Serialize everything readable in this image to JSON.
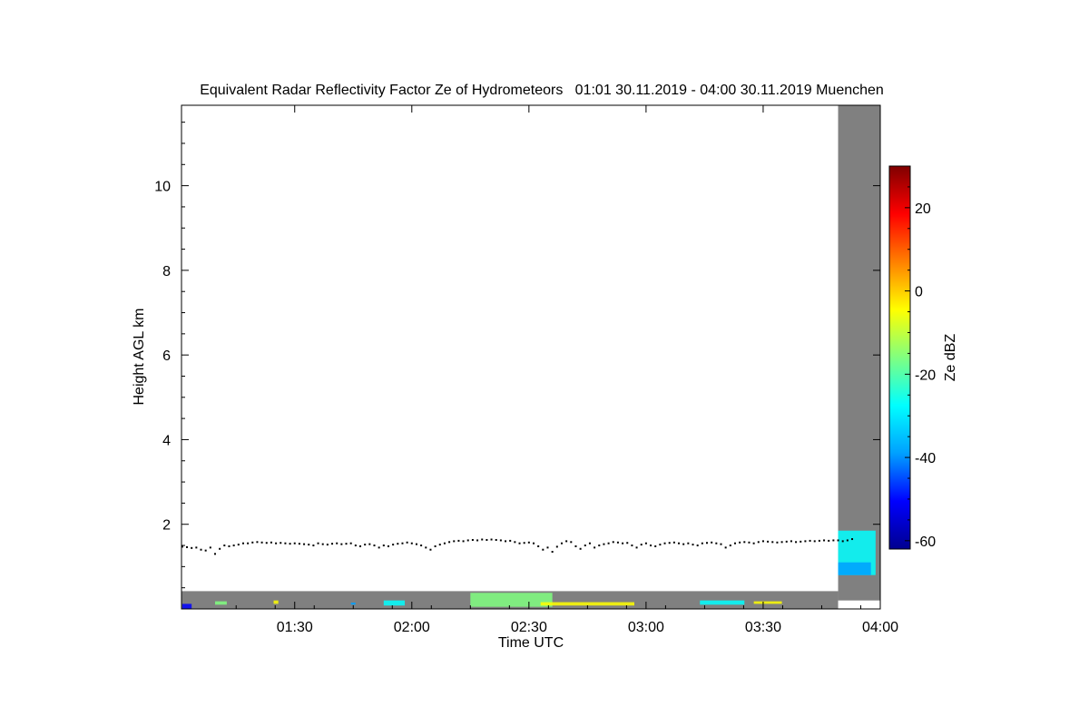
{
  "chart_data": {
    "type": "heatmap",
    "title": "Equivalent Radar Reflectivity Factor Ze of Hydrometeors   01:01 30.11.2019 - 04:00 30.11.2019 Muenchen",
    "xlabel": "Time UTC",
    "ylabel": "Height AGL km",
    "xlim": [
      1.0167,
      4.0
    ],
    "ylim": [
      0,
      11.9
    ],
    "x_ticks": [
      {
        "value": 1.5,
        "label": "01:30"
      },
      {
        "value": 2.0,
        "label": "02:00"
      },
      {
        "value": 2.5,
        "label": "02:30"
      },
      {
        "value": 3.0,
        "label": "03:00"
      },
      {
        "value": 3.5,
        "label": "03:30"
      },
      {
        "value": 4.0,
        "label": "04:00"
      }
    ],
    "y_ticks": [
      {
        "value": 2,
        "label": "2"
      },
      {
        "value": 4,
        "label": "4"
      },
      {
        "value": 6,
        "label": "6"
      },
      {
        "value": 8,
        "label": "8"
      },
      {
        "value": 10,
        "label": "10"
      }
    ],
    "colorbar": {
      "label": "Ze dBZ",
      "range": [
        -62,
        30
      ],
      "ticks": [
        {
          "value": 20,
          "label": "20"
        },
        {
          "value": 0,
          "label": "0"
        },
        {
          "value": -20,
          "label": "-20"
        },
        {
          "value": -40,
          "label": "-40"
        },
        {
          "value": -60,
          "label": "-60"
        }
      ],
      "colors": [
        "#00008f",
        "#0000ff",
        "#00a0ff",
        "#00ffff",
        "#80ff80",
        "#ffff00",
        "#ff8000",
        "#ff0000",
        "#800000"
      ]
    },
    "no_data_regions": [
      {
        "x": [
          1.0167,
          3.82
        ],
        "y": [
          0,
          0.42
        ],
        "color": "#808080"
      },
      {
        "x": [
          3.82,
          4.0
        ],
        "y": [
          0.2,
          11.9
        ],
        "color": "#808080"
      }
    ],
    "cloud_base_series": {
      "name": "",
      "color": "#000000",
      "points": [
        [
          1.02,
          1.47
        ],
        [
          1.04,
          1.46
        ],
        [
          1.06,
          1.44
        ],
        [
          1.08,
          1.45
        ],
        [
          1.1,
          1.4
        ],
        [
          1.12,
          1.38
        ],
        [
          1.14,
          1.45
        ],
        [
          1.16,
          1.3
        ],
        [
          1.18,
          1.42
        ],
        [
          1.2,
          1.5
        ],
        [
          1.22,
          1.48
        ],
        [
          1.24,
          1.5
        ],
        [
          1.26,
          1.52
        ],
        [
          1.28,
          1.55
        ],
        [
          1.3,
          1.55
        ],
        [
          1.32,
          1.57
        ],
        [
          1.34,
          1.58
        ],
        [
          1.36,
          1.57
        ],
        [
          1.38,
          1.56
        ],
        [
          1.4,
          1.57
        ],
        [
          1.42,
          1.55
        ],
        [
          1.44,
          1.56
        ],
        [
          1.46,
          1.55
        ],
        [
          1.48,
          1.54
        ],
        [
          1.5,
          1.55
        ],
        [
          1.52,
          1.54
        ],
        [
          1.54,
          1.53
        ],
        [
          1.56,
          1.52
        ],
        [
          1.58,
          1.5
        ],
        [
          1.6,
          1.55
        ],
        [
          1.62,
          1.53
        ],
        [
          1.64,
          1.52
        ],
        [
          1.66,
          1.54
        ],
        [
          1.68,
          1.55
        ],
        [
          1.7,
          1.53
        ],
        [
          1.72,
          1.54
        ],
        [
          1.74,
          1.55
        ],
        [
          1.76,
          1.5
        ],
        [
          1.78,
          1.48
        ],
        [
          1.8,
          1.52
        ],
        [
          1.82,
          1.53
        ],
        [
          1.84,
          1.5
        ],
        [
          1.86,
          1.45
        ],
        [
          1.88,
          1.5
        ],
        [
          1.9,
          1.48
        ],
        [
          1.92,
          1.52
        ],
        [
          1.94,
          1.54
        ],
        [
          1.96,
          1.55
        ],
        [
          1.98,
          1.57
        ],
        [
          2.0,
          1.55
        ],
        [
          2.02,
          1.53
        ],
        [
          2.04,
          1.5
        ],
        [
          2.06,
          1.45
        ],
        [
          2.08,
          1.4
        ],
        [
          2.1,
          1.48
        ],
        [
          2.12,
          1.52
        ],
        [
          2.14,
          1.55
        ],
        [
          2.16,
          1.58
        ],
        [
          2.18,
          1.6
        ],
        [
          2.2,
          1.61
        ],
        [
          2.22,
          1.6
        ],
        [
          2.24,
          1.62
        ],
        [
          2.26,
          1.63
        ],
        [
          2.28,
          1.62
        ],
        [
          2.3,
          1.64
        ],
        [
          2.32,
          1.63
        ],
        [
          2.34,
          1.64
        ],
        [
          2.36,
          1.63
        ],
        [
          2.38,
          1.62
        ],
        [
          2.4,
          1.6
        ],
        [
          2.42,
          1.61
        ],
        [
          2.44,
          1.58
        ],
        [
          2.46,
          1.55
        ],
        [
          2.48,
          1.56
        ],
        [
          2.5,
          1.57
        ],
        [
          2.52,
          1.55
        ],
        [
          2.54,
          1.48
        ],
        [
          2.56,
          1.4
        ],
        [
          2.58,
          1.45
        ],
        [
          2.6,
          1.35
        ],
        [
          2.62,
          1.47
        ],
        [
          2.64,
          1.55
        ],
        [
          2.66,
          1.6
        ],
        [
          2.68,
          1.58
        ],
        [
          2.7,
          1.48
        ],
        [
          2.72,
          1.42
        ],
        [
          2.74,
          1.5
        ],
        [
          2.76,
          1.55
        ],
        [
          2.78,
          1.45
        ],
        [
          2.8,
          1.5
        ],
        [
          2.82,
          1.53
        ],
        [
          2.84,
          1.55
        ],
        [
          2.86,
          1.58
        ],
        [
          2.88,
          1.57
        ],
        [
          2.9,
          1.55
        ],
        [
          2.92,
          1.56
        ],
        [
          2.94,
          1.5
        ],
        [
          2.96,
          1.45
        ],
        [
          2.98,
          1.52
        ],
        [
          3.0,
          1.55
        ],
        [
          3.02,
          1.5
        ],
        [
          3.04,
          1.48
        ],
        [
          3.06,
          1.52
        ],
        [
          3.08,
          1.55
        ],
        [
          3.1,
          1.56
        ],
        [
          3.12,
          1.57
        ],
        [
          3.14,
          1.55
        ],
        [
          3.16,
          1.53
        ],
        [
          3.18,
          1.55
        ],
        [
          3.2,
          1.52
        ],
        [
          3.22,
          1.5
        ],
        [
          3.24,
          1.55
        ],
        [
          3.26,
          1.56
        ],
        [
          3.28,
          1.57
        ],
        [
          3.3,
          1.55
        ],
        [
          3.32,
          1.53
        ],
        [
          3.34,
          1.45
        ],
        [
          3.36,
          1.5
        ],
        [
          3.38,
          1.55
        ],
        [
          3.4,
          1.57
        ],
        [
          3.42,
          1.58
        ],
        [
          3.44,
          1.57
        ],
        [
          3.46,
          1.55
        ],
        [
          3.48,
          1.58
        ],
        [
          3.5,
          1.6
        ],
        [
          3.52,
          1.59
        ],
        [
          3.54,
          1.58
        ],
        [
          3.56,
          1.57
        ],
        [
          3.58,
          1.58
        ],
        [
          3.6,
          1.59
        ],
        [
          3.62,
          1.6
        ],
        [
          3.64,
          1.58
        ],
        [
          3.66,
          1.59
        ],
        [
          3.68,
          1.6
        ],
        [
          3.7,
          1.61
        ],
        [
          3.72,
          1.6
        ],
        [
          3.74,
          1.61
        ],
        [
          3.76,
          1.62
        ],
        [
          3.78,
          1.61
        ],
        [
          3.8,
          1.62
        ],
        [
          3.82,
          1.62
        ],
        [
          3.84,
          1.6
        ],
        [
          3.86,
          1.62
        ],
        [
          3.88,
          1.65
        ]
      ]
    },
    "echoes": [
      {
        "x": [
          1.02,
          1.06
        ],
        "y": [
          0.0,
          0.12
        ],
        "ze": -45
      },
      {
        "x": [
          1.16,
          1.21
        ],
        "y": [
          0.1,
          0.18
        ],
        "ze": -15
      },
      {
        "x": [
          1.41,
          1.43
        ],
        "y": [
          0.12,
          0.2
        ],
        "ze": -10
      },
      {
        "x": [
          1.74,
          1.76
        ],
        "y": [
          0.1,
          0.15
        ],
        "ze": -40
      },
      {
        "x": [
          1.88,
          1.97
        ],
        "y": [
          0.08,
          0.2
        ],
        "ze": -22
      },
      {
        "x": [
          2.25,
          2.6
        ],
        "y": [
          0.05,
          0.38
        ],
        "ze": -18
      },
      {
        "x": [
          2.55,
          2.95
        ],
        "y": [
          0.08,
          0.16
        ],
        "ze": -8
      },
      {
        "x": [
          3.23,
          3.42
        ],
        "y": [
          0.1,
          0.2
        ],
        "ze": -25
      },
      {
        "x": [
          3.46,
          3.58
        ],
        "y": [
          0.12,
          0.18
        ],
        "ze": -10
      },
      {
        "x": [
          3.82,
          3.98
        ],
        "y": [
          0.8,
          1.85
        ],
        "ze": -30
      },
      {
        "x": [
          3.82,
          3.96
        ],
        "y": [
          0.8,
          1.1
        ],
        "ze": -42
      }
    ]
  }
}
